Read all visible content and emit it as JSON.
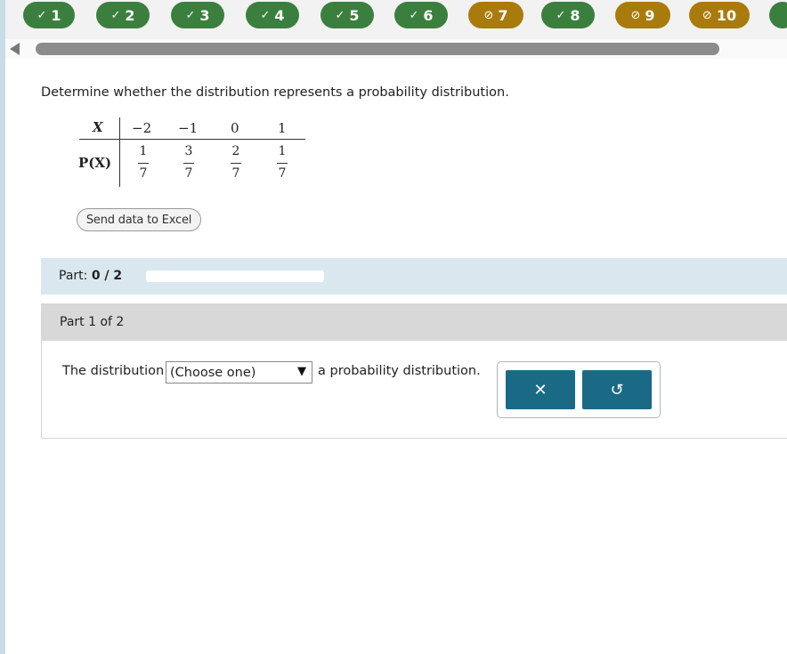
{
  "nav": {
    "questions": [
      {
        "label": "1",
        "status": "correct",
        "mark": "✓"
      },
      {
        "label": "2",
        "status": "correct",
        "mark": "✓"
      },
      {
        "label": "3",
        "status": "correct",
        "mark": "✓"
      },
      {
        "label": "4",
        "status": "correct",
        "mark": "✓"
      },
      {
        "label": "5",
        "status": "correct",
        "mark": "✓"
      },
      {
        "label": "6",
        "status": "correct",
        "mark": "✓"
      },
      {
        "label": "7",
        "status": "partial",
        "mark": "⊘"
      },
      {
        "label": "8",
        "status": "correct",
        "mark": "✓"
      },
      {
        "label": "9",
        "status": "partial",
        "mark": "⊘"
      },
      {
        "label": "10",
        "status": "partial",
        "mark": "⊘"
      }
    ],
    "colors": {
      "correct": "#3b7f3e",
      "partial": "#a97b0d"
    }
  },
  "question": {
    "prompt": "Determine whether the distribution represents a probability distribution.",
    "table": {
      "x_header": "X",
      "p_header": "P(X)",
      "x_values": [
        "−2",
        "−1",
        "0",
        "1"
      ],
      "probabilities": [
        {
          "num": "1",
          "den": "7"
        },
        {
          "num": "3",
          "den": "7"
        },
        {
          "num": "2",
          "den": "7"
        },
        {
          "num": "1",
          "den": "7"
        }
      ]
    },
    "excel_button": "Send data to Excel"
  },
  "progress": {
    "label": "Part:",
    "value": "0 / 2",
    "fraction": 0
  },
  "part": {
    "heading": "Part 1 of 2",
    "sentence_before": "The distribution",
    "select_value": "(Choose one)",
    "sentence_after": "a probability distribution.",
    "clear_icon": "✕",
    "undo_icon": "↺"
  }
}
